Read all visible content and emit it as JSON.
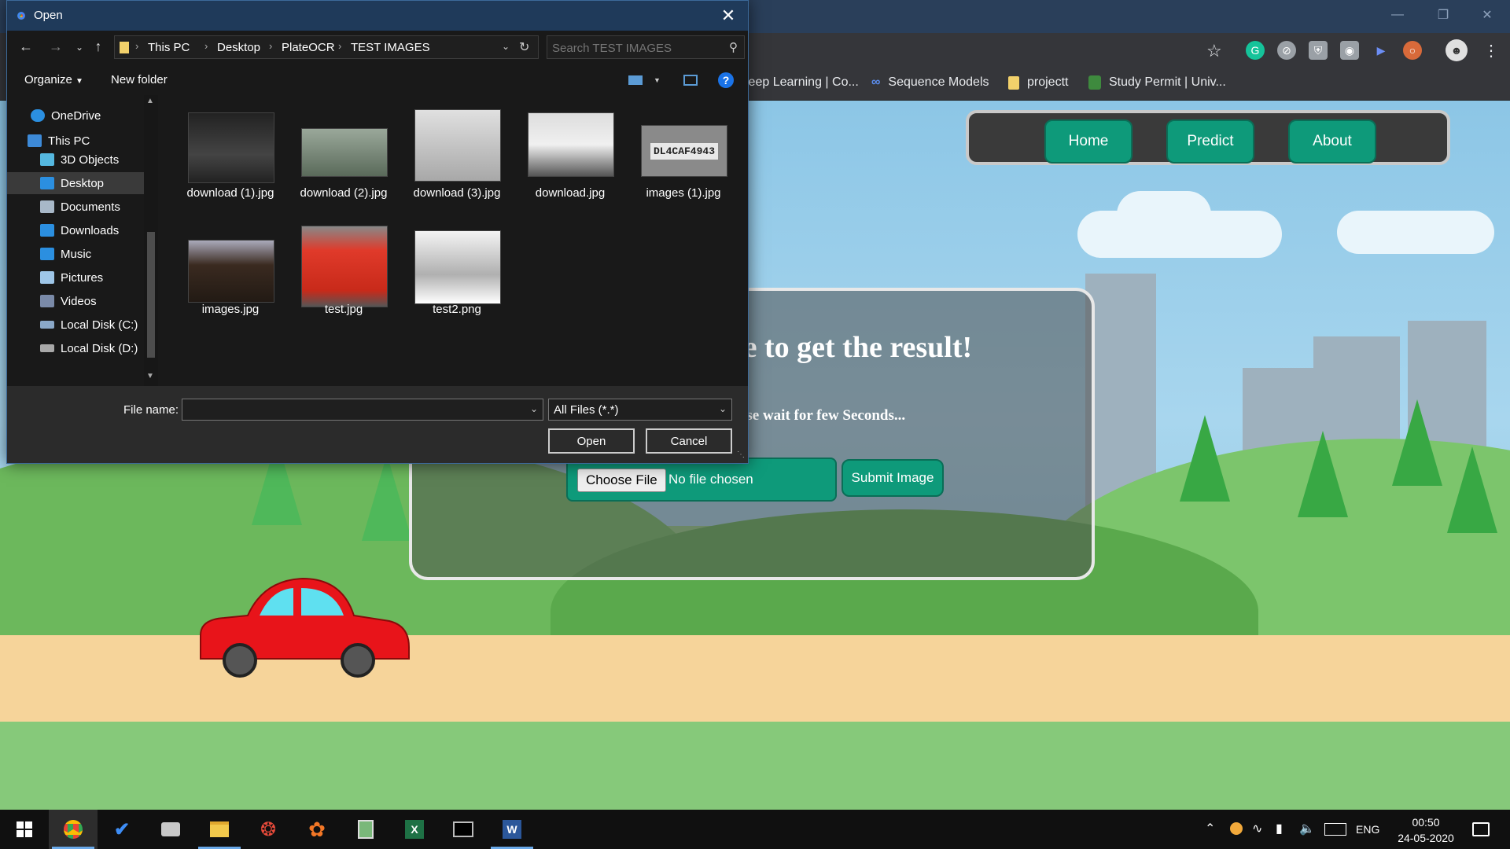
{
  "browser": {
    "bookmarks": [
      {
        "label": "Deep Learning | Co...",
        "icon": "bookmark-page-icon"
      },
      {
        "label": "Sequence Models",
        "icon": "coursera-infinity-icon"
      },
      {
        "label": "projectt",
        "icon": "folder-icon"
      },
      {
        "label": "Study Permit | Univ...",
        "icon": "university-crest-icon"
      }
    ]
  },
  "website": {
    "nav": {
      "home": "Home",
      "predict": "Predict",
      "about": "About"
    },
    "card": {
      "heading": "Choose an Image to get the result!",
      "subtext": "Submit an image, please wait for few Seconds...",
      "choose_file": "Choose File",
      "no_file": "No file chosen",
      "submit": "Submit Image"
    }
  },
  "dialog": {
    "title": "Open",
    "breadcrumb": [
      "This PC",
      "Desktop",
      "PlateOCR",
      "TEST IMAGES"
    ],
    "search_placeholder": "Search TEST IMAGES",
    "organize": "Organize",
    "new_folder": "New folder",
    "nav_pane": [
      {
        "label": "OneDrive",
        "icon": "onedrive-cloud-icon"
      },
      {
        "label": "This PC",
        "icon": "computer-icon"
      },
      {
        "label": "3D Objects",
        "icon": "3d-objects-icon"
      },
      {
        "label": "Desktop",
        "icon": "desktop-icon",
        "selected": true
      },
      {
        "label": "Documents",
        "icon": "documents-icon"
      },
      {
        "label": "Downloads",
        "icon": "downloads-icon"
      },
      {
        "label": "Music",
        "icon": "music-icon"
      },
      {
        "label": "Pictures",
        "icon": "pictures-icon"
      },
      {
        "label": "Videos",
        "icon": "videos-icon"
      },
      {
        "label": "Local Disk (C:)",
        "icon": "drive-icon"
      },
      {
        "label": "Local Disk (D:)",
        "icon": "drive-icon"
      }
    ],
    "files": [
      {
        "name": "download (1).jpg",
        "thumb_color": "#2c2c2c"
      },
      {
        "name": "download (2).jpg",
        "thumb_color": "#6d7a6a"
      },
      {
        "name": "download (3).jpg",
        "thumb_color": "#b8b8b8"
      },
      {
        "name": "download.jpg",
        "thumb_color": "#d8d8d8"
      },
      {
        "name": "images (1).jpg",
        "thumb_color": "#8a8a8a",
        "plate": "DL4CAF4943"
      },
      {
        "name": "images.jpg",
        "thumb_color": "#3a2a20"
      },
      {
        "name": "test.jpg",
        "thumb_color": "#d83a2a"
      },
      {
        "name": "test2.png",
        "thumb_color": "#c4c4c4"
      }
    ],
    "file_name_label": "File name:",
    "file_name_value": "",
    "filter": "All Files (*.*)",
    "open": "Open",
    "cancel": "Cancel"
  },
  "taskbar": {
    "language": "ENG",
    "time": "00:50",
    "date": "24-05-2020"
  }
}
